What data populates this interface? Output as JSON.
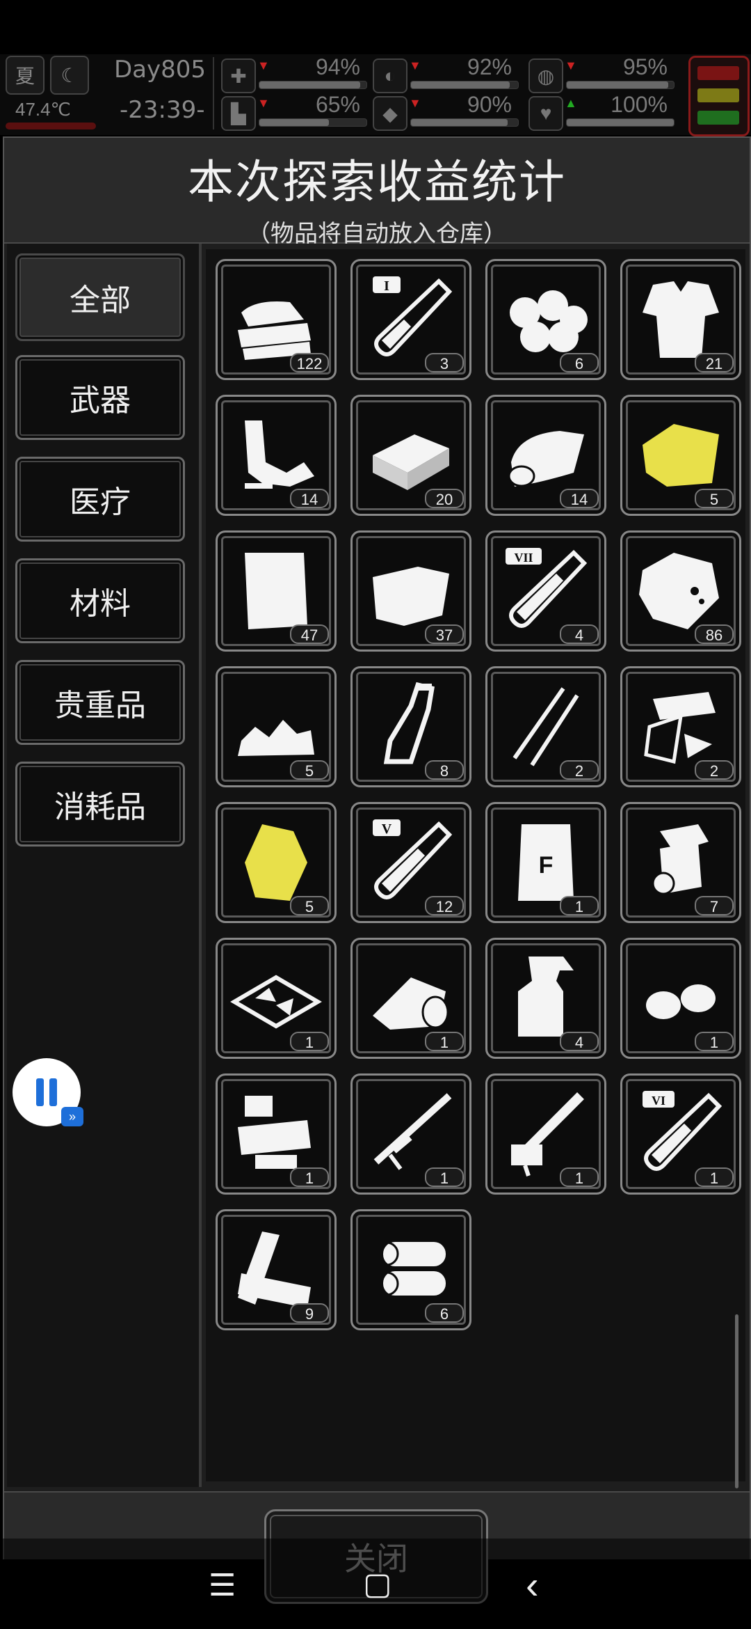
{
  "hud": {
    "season": "夏",
    "temperature": "47.4℃",
    "day": "Day805",
    "time": "-23:39-",
    "stats": [
      {
        "name": "health",
        "value": "94%",
        "level": 0.94,
        "trend": "down"
      },
      {
        "name": "hunger",
        "value": "92%",
        "level": 0.92,
        "trend": "down"
      },
      {
        "name": "mood",
        "value": "95%",
        "level": 0.95,
        "trend": "down"
      },
      {
        "name": "stamina",
        "value": "65%",
        "level": 0.65,
        "trend": "down"
      },
      {
        "name": "thirst",
        "value": "90%",
        "level": 0.9,
        "trend": "down"
      },
      {
        "name": "heart",
        "value": "100%",
        "level": 1.0,
        "trend": "up"
      }
    ],
    "alert_colors": [
      "#7a1414",
      "#7d7a16",
      "#1f6e1f"
    ]
  },
  "dialog": {
    "title": "本次探索收益统计",
    "subtitle": "（物品将自动放入仓库）",
    "categories": [
      {
        "label": "全部",
        "active": true
      },
      {
        "label": "武器",
        "active": false
      },
      {
        "label": "医疗",
        "active": false
      },
      {
        "label": "材料",
        "active": false
      },
      {
        "label": "贵重品",
        "active": false
      },
      {
        "label": "消耗品",
        "active": false
      }
    ],
    "items": [
      {
        "icon": "folded-cloth-icon",
        "count": "122"
      },
      {
        "icon": "test-tube-I-icon",
        "count": "3"
      },
      {
        "icon": "cotton-balls-icon",
        "count": "6"
      },
      {
        "icon": "torn-shirt-icon",
        "count": "21"
      },
      {
        "icon": "scrap-parts-icon",
        "count": "14"
      },
      {
        "icon": "brick-icon",
        "count": "20"
      },
      {
        "icon": "rolled-cloth-icon",
        "count": "14"
      },
      {
        "icon": "yellow-cloth-icon",
        "count": "5"
      },
      {
        "icon": "paper-sheet-icon",
        "count": "47"
      },
      {
        "icon": "fabric-sheet-icon",
        "count": "37"
      },
      {
        "icon": "test-tube-VII-icon",
        "count": "4"
      },
      {
        "icon": "ore-rock-icon",
        "count": "86"
      },
      {
        "icon": "gravel-icon",
        "count": "5"
      },
      {
        "icon": "bottle-icon",
        "count": "8"
      },
      {
        "icon": "tweezers-icon",
        "count": "2"
      },
      {
        "icon": "glass-shards-icon",
        "count": "2"
      },
      {
        "icon": "gold-nugget-icon",
        "count": "5"
      },
      {
        "icon": "test-tube-V-icon",
        "count": "12"
      },
      {
        "icon": "flour-bag-icon",
        "count": "1"
      },
      {
        "icon": "paper-roll-icon",
        "count": "7"
      },
      {
        "icon": "crystal-tray-icon",
        "count": "1"
      },
      {
        "icon": "bandage-roll-icon",
        "count": "1"
      },
      {
        "icon": "spray-bottle-icon",
        "count": "4"
      },
      {
        "icon": "seeds-icon",
        "count": "1"
      },
      {
        "icon": "machine-parts-icon",
        "count": "1"
      },
      {
        "icon": "rocket-launcher-icon",
        "count": "1"
      },
      {
        "icon": "gatling-gun-icon",
        "count": "1"
      },
      {
        "icon": "test-tube-VI-icon",
        "count": "1"
      },
      {
        "icon": "wood-planks-icon",
        "count": "9"
      },
      {
        "icon": "logs-icon",
        "count": "6"
      }
    ],
    "close_label": "关闭"
  },
  "navbar": {
    "menu": "☰",
    "home": "▢",
    "back": "‹"
  }
}
